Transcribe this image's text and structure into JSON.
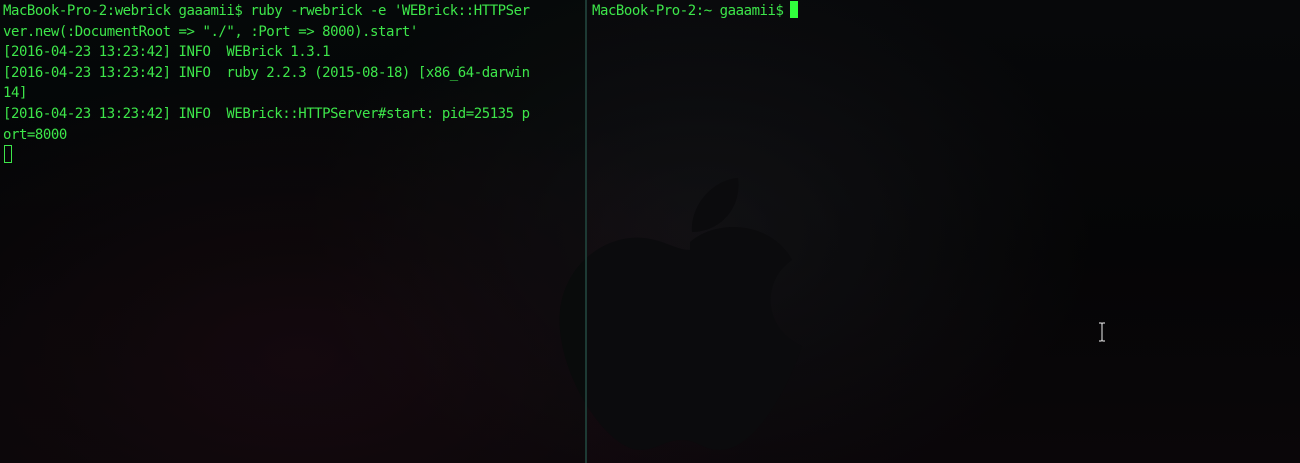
{
  "colors": {
    "terminal_text": "#3de64a",
    "cursor": "#31ff3d",
    "divider": "#1d3a34",
    "background": "#050507"
  },
  "left_pane": {
    "lines": [
      "MacBook-Pro-2:webrick gaaamii$ ruby -rwebrick -e 'WEBrick::HTTPSer",
      "ver.new(:DocumentRoot => \"./\", :Port => 8000).start'",
      "[2016-04-23 13:23:42] INFO  WEBrick 1.3.1",
      "[2016-04-23 13:23:42] INFO  ruby 2.2.3 (2015-08-18) [x86_64-darwin",
      "14]",
      "[2016-04-23 13:23:42] INFO  WEBrick::HTTPServer#start: pid=25135 p",
      "ort=8000"
    ]
  },
  "right_pane": {
    "prompt": "MacBook-Pro-2:~ gaaamii$"
  },
  "icons": {
    "background": "apple-logo-icon",
    "pointer": "text-cursor-icon"
  }
}
